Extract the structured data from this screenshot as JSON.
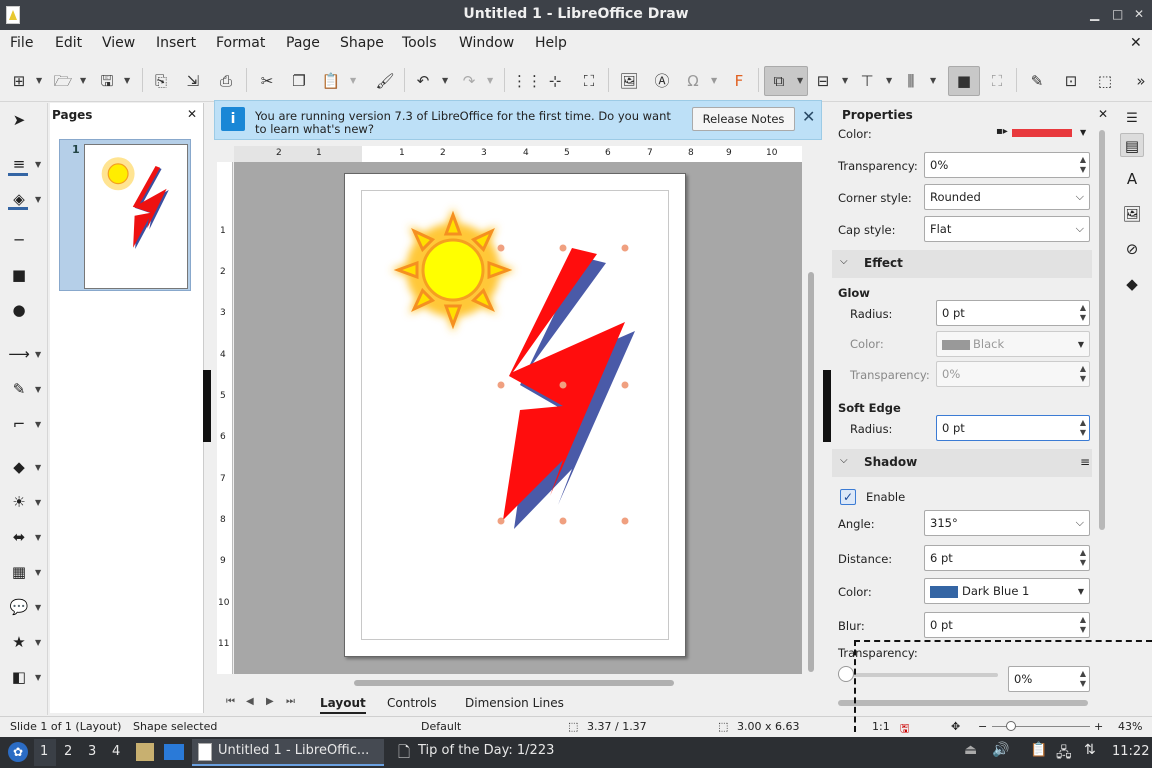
{
  "window": {
    "title": "Untitled 1 - LibreOffice Draw"
  },
  "menu": [
    "File",
    "Edit",
    "View",
    "Insert",
    "Format",
    "Page",
    "Shape",
    "Tools",
    "Window",
    "Help"
  ],
  "pages_panel": {
    "title": "Pages",
    "page_number": "1"
  },
  "infobar": {
    "message": "You are running version 7.3 of LibreOffice for the first time. Do you want to learn what's new?",
    "button": "Release Notes"
  },
  "ruler_h": [
    "2",
    "1",
    "1",
    "2",
    "3",
    "4",
    "5",
    "6",
    "7",
    "8",
    "9",
    "10"
  ],
  "ruler_v": [
    "1",
    "2",
    "3",
    "4",
    "5",
    "6",
    "7",
    "8",
    "9",
    "10",
    "11"
  ],
  "tabs": {
    "active": "Layout",
    "items": [
      "Layout",
      "Controls",
      "Dimension Lines"
    ]
  },
  "properties": {
    "title": "Properties",
    "color_label": "Color:",
    "transparency": {
      "label": "Transparency:",
      "value": "0%"
    },
    "corner_style": {
      "label": "Corner style:",
      "value": "Rounded"
    },
    "cap_style": {
      "label": "Cap style:",
      "value": "Flat"
    },
    "effect": {
      "title": "Effect",
      "glow": {
        "title": "Glow",
        "radius_label": "Radius:",
        "radius": "0 pt",
        "color_label": "Color:",
        "color": "Black",
        "transparency_label": "Transparency:",
        "transparency": "0%"
      },
      "soft_edge": {
        "title": "Soft Edge",
        "radius_label": "Radius:",
        "radius": "0 pt"
      }
    },
    "shadow": {
      "title": "Shadow",
      "enable": "Enable",
      "angle_label": "Angle:",
      "angle": "315°",
      "distance_label": "Distance:",
      "distance": "6 pt",
      "color_label": "Color:",
      "color": "Dark Blue 1",
      "blur_label": "Blur:",
      "blur": "0 pt",
      "transparency_label": "Transparency:",
      "transparency": "0%"
    }
  },
  "colors": {
    "line_color": "#e8393d",
    "shadow_color": "#3465a4",
    "accent": "#3b7bd4"
  },
  "status": {
    "slide": "Slide 1 of 1 (Layout)",
    "selection": "Shape selected",
    "layout": "Default",
    "position": "3.37 / 1.37",
    "size": "3.00 x 6.63",
    "scale": "1:1",
    "zoom": "43%"
  },
  "taskbar": {
    "workspaces": [
      "1",
      "2",
      "3",
      "4"
    ],
    "task1": "Untitled 1 - LibreOffic...",
    "task2": "Tip of the Day: 1/223",
    "time": "11:22"
  }
}
